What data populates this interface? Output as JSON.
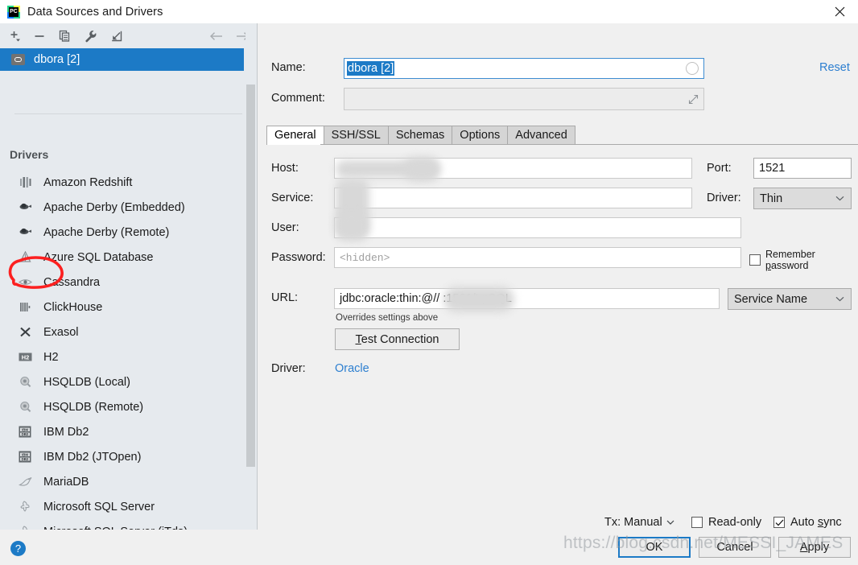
{
  "window": {
    "title": "Data Sources and Drivers",
    "app_icon": "pycharm-icon",
    "close_label": "✕"
  },
  "left_panel": {
    "toolbar": [
      {
        "name": "add-datasource-button",
        "glyph": "+"
      },
      {
        "name": "remove-datasource-button",
        "glyph": "−"
      },
      {
        "name": "copy-datasource-button",
        "glyph": "copy"
      },
      {
        "name": "properties-button",
        "glyph": "wrench"
      },
      {
        "name": "import-button",
        "glyph": "import-arrow"
      },
      {
        "name": "nav-back-button",
        "glyph": "←"
      },
      {
        "name": "nav-forward-button",
        "glyph": "→"
      }
    ],
    "datasource": {
      "label": "dbora [2]",
      "icon": "database-icon",
      "selected": true
    },
    "drivers_header": "Drivers",
    "drivers": [
      {
        "label": "Amazon Redshift",
        "icon": "redshift-icon"
      },
      {
        "label": "Apache Derby (Embedded)",
        "icon": "derby-icon"
      },
      {
        "label": "Apache Derby (Remote)",
        "icon": "derby-icon"
      },
      {
        "label": "Azure SQL Database",
        "icon": "azure-icon"
      },
      {
        "label": "Cassandra",
        "icon": "cassandra-icon"
      },
      {
        "label": "ClickHouse",
        "icon": "clickhouse-icon"
      },
      {
        "label": "Exasol",
        "icon": "exasol-icon"
      },
      {
        "label": "H2",
        "icon": "h2-icon"
      },
      {
        "label": "HSQLDB (Local)",
        "icon": "hsqldb-icon"
      },
      {
        "label": "HSQLDB (Remote)",
        "icon": "hsqldb-icon"
      },
      {
        "label": "IBM Db2",
        "icon": "db2-icon"
      },
      {
        "label": "IBM Db2 (JTOpen)",
        "icon": "db2-icon"
      },
      {
        "label": "MariaDB",
        "icon": "mariadb-icon"
      },
      {
        "label": "Microsoft SQL Server",
        "icon": "mssql-icon"
      },
      {
        "label": "Microsoft SQL Server (jTds)",
        "icon": "mssql-icon"
      }
    ]
  },
  "form": {
    "name_label": "Name:",
    "name_value": "dbora [2]",
    "reset_label": "Reset",
    "comment_label": "Comment:",
    "comment_value": "",
    "tabs": [
      {
        "label": "General",
        "active": true
      },
      {
        "label": "SSH/SSL",
        "active": false
      },
      {
        "label": "Schemas",
        "active": false
      },
      {
        "label": "Options",
        "active": false
      },
      {
        "label": "Advanced",
        "active": false
      }
    ],
    "host_label": "Host:",
    "host_value": "",
    "port_label": "Port:",
    "port_value": "1521",
    "service_label": "Service:",
    "service_value": "",
    "driver_label": "Driver:",
    "driver_value": "Thin",
    "user_label": "User:",
    "user_value": "",
    "password_label": "Password:",
    "password_placeholder": "<hidden>",
    "remember_password_label": "Remember password",
    "remember_password_checked": false,
    "url_label": "URL:",
    "url_value": "jdbc:oracle:thin:@//            :1521/LpSQL",
    "url_kind_value": "Service Name",
    "overrides_note": "Overrides settings above",
    "test_connection_label": "Test Connection",
    "driver2_label": "Driver:",
    "driver2_link": "Oracle"
  },
  "bottom_options": {
    "tx_label": "Tx: Manual",
    "read_only_label": "Read-only",
    "read_only_checked": false,
    "auto_sync_label": "Auto sync",
    "auto_sync_checked": true
  },
  "dialog_buttons": {
    "help_glyph": "?",
    "ok_label": "OK",
    "cancel_label": "Cancel",
    "apply_label": "Apply"
  },
  "watermark": {
    "text": "https://blog.csdn.net/MESSI_JAMES"
  },
  "annotation": {
    "type": "red-hand-drawn-circle",
    "target": "URL:",
    "color": "#fc2020"
  }
}
